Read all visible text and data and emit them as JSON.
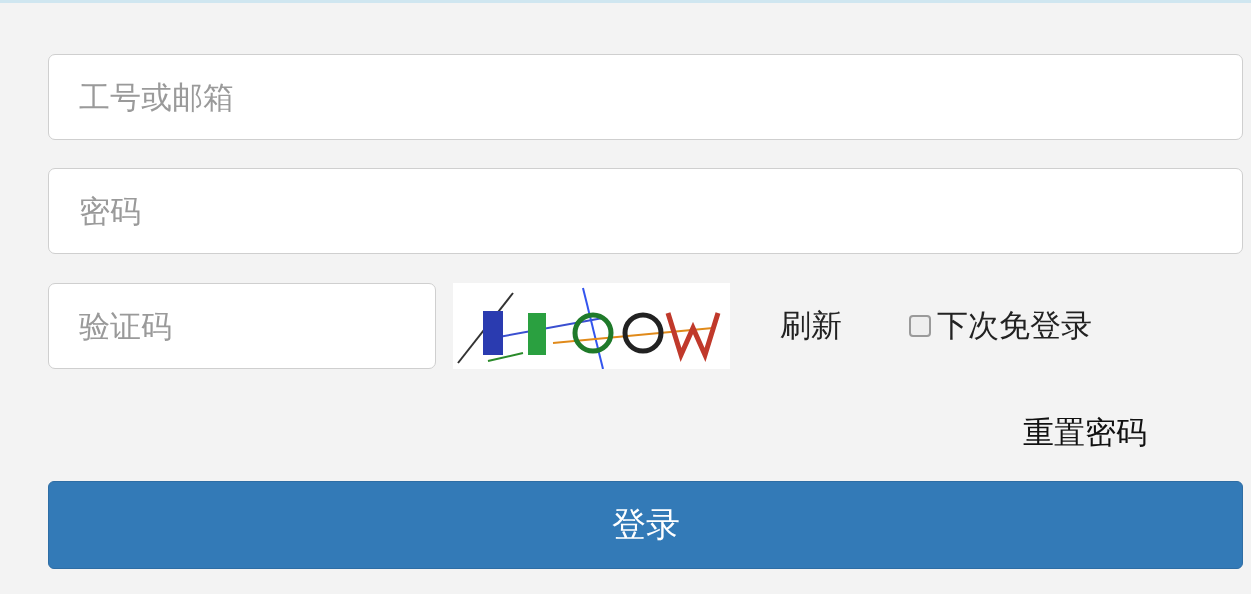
{
  "fields": [
    {
      "placeholder": "工号或邮箱"
    },
    {
      "placeholder": "密码"
    }
  ],
  "captcha": {
    "placeholder": "验证码",
    "refresh": "刷新"
  },
  "remember": {
    "label": "下次免登录",
    "checked": false
  },
  "reset_link": "重置密码",
  "login_button": "登录"
}
